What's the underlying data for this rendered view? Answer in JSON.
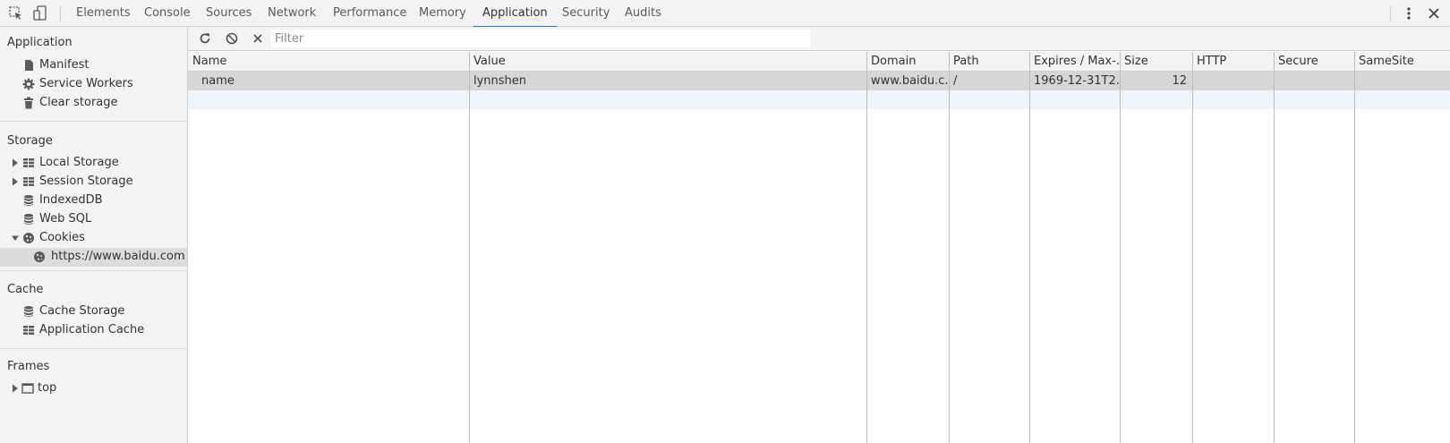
{
  "topbar": {
    "tabs": [
      {
        "label": "Elements",
        "active": false
      },
      {
        "label": "Console",
        "active": false
      },
      {
        "label": "Sources",
        "active": false
      },
      {
        "label": "Network",
        "active": false
      },
      {
        "label": "Performance",
        "active": false
      },
      {
        "label": "Memory",
        "active": false
      },
      {
        "label": "Application",
        "active": true
      },
      {
        "label": "Security",
        "active": false
      },
      {
        "label": "Audits",
        "active": false
      }
    ],
    "icons": [
      "inspect-element-icon",
      "device-toolbar-icon",
      "more-options-icon",
      "close-icon"
    ],
    "accent_color": "#1a73e8"
  },
  "sidebar": {
    "application": {
      "title": "Application",
      "items": [
        {
          "label": "Manifest",
          "icon": "file-icon"
        },
        {
          "label": "Service Workers",
          "icon": "gear-icon"
        },
        {
          "label": "Clear storage",
          "icon": "trash-icon"
        }
      ]
    },
    "storage": {
      "title": "Storage",
      "items": [
        {
          "label": "Local Storage",
          "icon": "grid-icon",
          "expandable": true,
          "expanded": false
        },
        {
          "label": "Session Storage",
          "icon": "grid-icon",
          "expandable": true,
          "expanded": false
        },
        {
          "label": "IndexedDB",
          "icon": "database-icon"
        },
        {
          "label": "Web SQL",
          "icon": "database-icon"
        },
        {
          "label": "Cookies",
          "icon": "cookie-icon",
          "expandable": true,
          "expanded": true
        },
        {
          "label": "https://www.baidu.com",
          "icon": "cookie-icon",
          "selected": true
        }
      ]
    },
    "cache": {
      "title": "Cache",
      "items": [
        {
          "label": "Cache Storage",
          "icon": "database-icon"
        },
        {
          "label": "Application Cache",
          "icon": "grid-icon"
        }
      ]
    },
    "frames": {
      "title": "Frames",
      "items": [
        {
          "label": "top",
          "icon": "frame-icon",
          "expandable": true,
          "expanded": false
        }
      ]
    }
  },
  "toolbar": {
    "icons": [
      "refresh-icon",
      "block-icon",
      "clear-icon"
    ],
    "filter_placeholder": "Filter",
    "filter_value": ""
  },
  "table": {
    "columns": [
      "Name",
      "Value",
      "Domain",
      "Path",
      "Expires / Max-...",
      "Size",
      "HTTP",
      "Secure",
      "SameSite"
    ],
    "rows": [
      {
        "name": "name",
        "value": "lynnshen",
        "domain": "www.baidu.c...",
        "path": "/",
        "expires": "1969-12-31T2...",
        "size": "12",
        "http": "",
        "secure": "",
        "samesite": ""
      }
    ]
  }
}
